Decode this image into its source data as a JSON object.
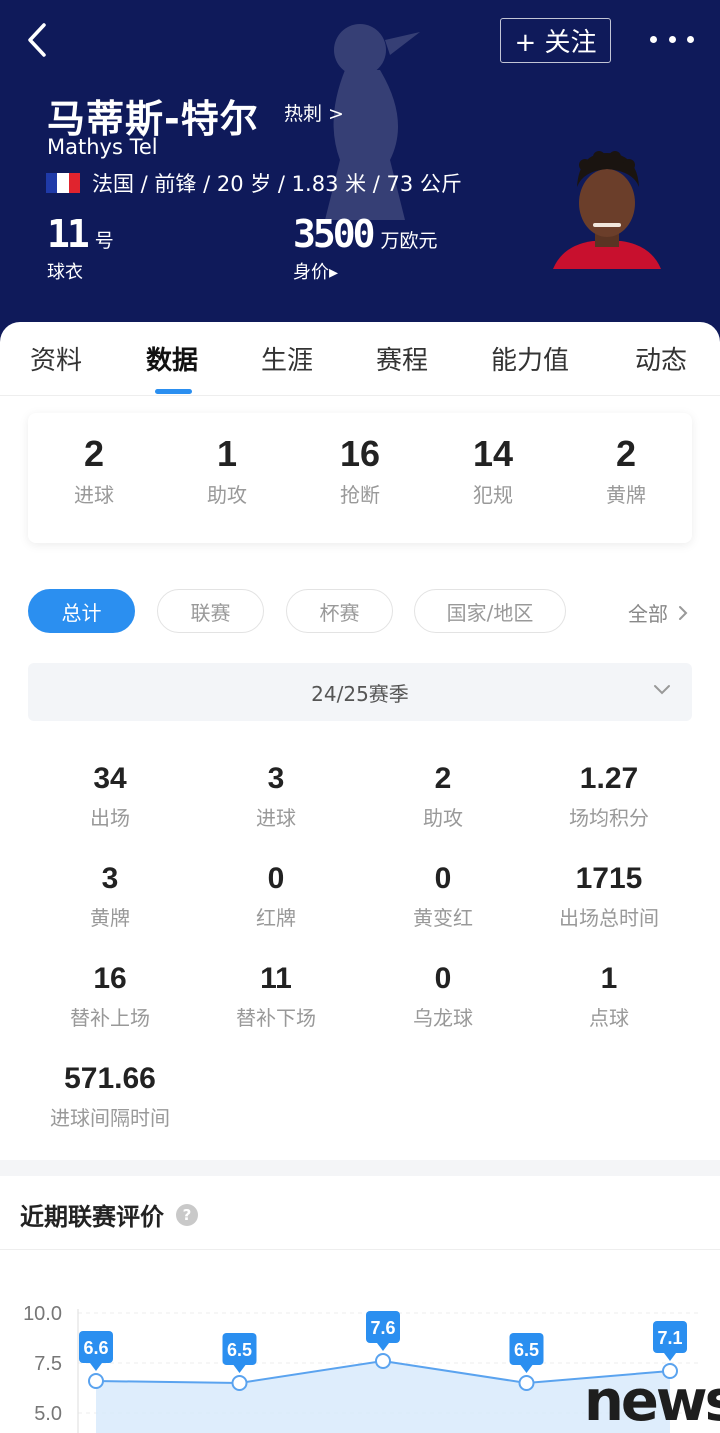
{
  "header": {
    "follow_label": "+ 关注",
    "player_name_cn": "马蒂斯-特尔",
    "team_link": "热刺 >",
    "player_name_en": "Mathys Tel",
    "info": "法国 / 前锋 / 20 岁 / 1.83 米 / 73 公斤",
    "shirt_number": "11",
    "shirt_unit": "号",
    "shirt_label": "球衣",
    "market_value": "3500",
    "market_value_unit": "万欧元",
    "market_value_label": "身价▸",
    "colors": {
      "header_bg": "#0f1a5a",
      "accent": "#2b8ff0"
    },
    "icons": [
      "back-arrow-icon",
      "more-dots-icon",
      "club-crest-watermark",
      "france-flag-icon"
    ]
  },
  "tabs": [
    {
      "label": "资料"
    },
    {
      "label": "数据"
    },
    {
      "label": "生涯"
    },
    {
      "label": "赛程"
    },
    {
      "label": "能力值"
    },
    {
      "label": "动态"
    }
  ],
  "summary": [
    {
      "value": "2",
      "label": "进球"
    },
    {
      "value": "1",
      "label": "助攻"
    },
    {
      "value": "16",
      "label": "抢断"
    },
    {
      "value": "14",
      "label": "犯规"
    },
    {
      "value": "2",
      "label": "黄牌"
    }
  ],
  "filters": {
    "pills": [
      {
        "label": "总计"
      },
      {
        "label": "联赛"
      },
      {
        "label": "杯赛"
      },
      {
        "label": "国家/地区"
      }
    ],
    "all_label": "全部"
  },
  "season": "24/25赛季",
  "stats": [
    {
      "value": "34",
      "label": "出场"
    },
    {
      "value": "3",
      "label": "进球"
    },
    {
      "value": "2",
      "label": "助攻"
    },
    {
      "value": "1.27",
      "label": "场均积分"
    },
    {
      "value": "3",
      "label": "黄牌"
    },
    {
      "value": "0",
      "label": "红牌"
    },
    {
      "value": "0",
      "label": "黄变红"
    },
    {
      "value": "1715",
      "label": "出场总时间"
    },
    {
      "value": "16",
      "label": "替补上场"
    },
    {
      "value": "11",
      "label": "替补下场"
    },
    {
      "value": "0",
      "label": "乌龙球"
    },
    {
      "value": "1",
      "label": "点球"
    },
    {
      "value": "571.66",
      "label": "进球间隔时间"
    }
  ],
  "rating": {
    "title": "近期联赛评价",
    "help_glyph": "?"
  },
  "chart_data": {
    "type": "area",
    "title": "",
    "xlabel": "",
    "ylabel": "",
    "y_tick_labels": [
      "10.0",
      "7.5",
      "5.0"
    ],
    "y_ticks": [
      10.0,
      7.5,
      5.0
    ],
    "ylim": [
      5.0,
      10.0
    ],
    "values": [
      6.6,
      6.5,
      7.6,
      6.5,
      7.1
    ],
    "data_labels": [
      "6.6",
      "6.5",
      "7.6",
      "6.5",
      "7.1"
    ],
    "line_color": "#5aa3ef",
    "label_color": "#2b8ff0",
    "grid": true
  },
  "watermark": "news"
}
